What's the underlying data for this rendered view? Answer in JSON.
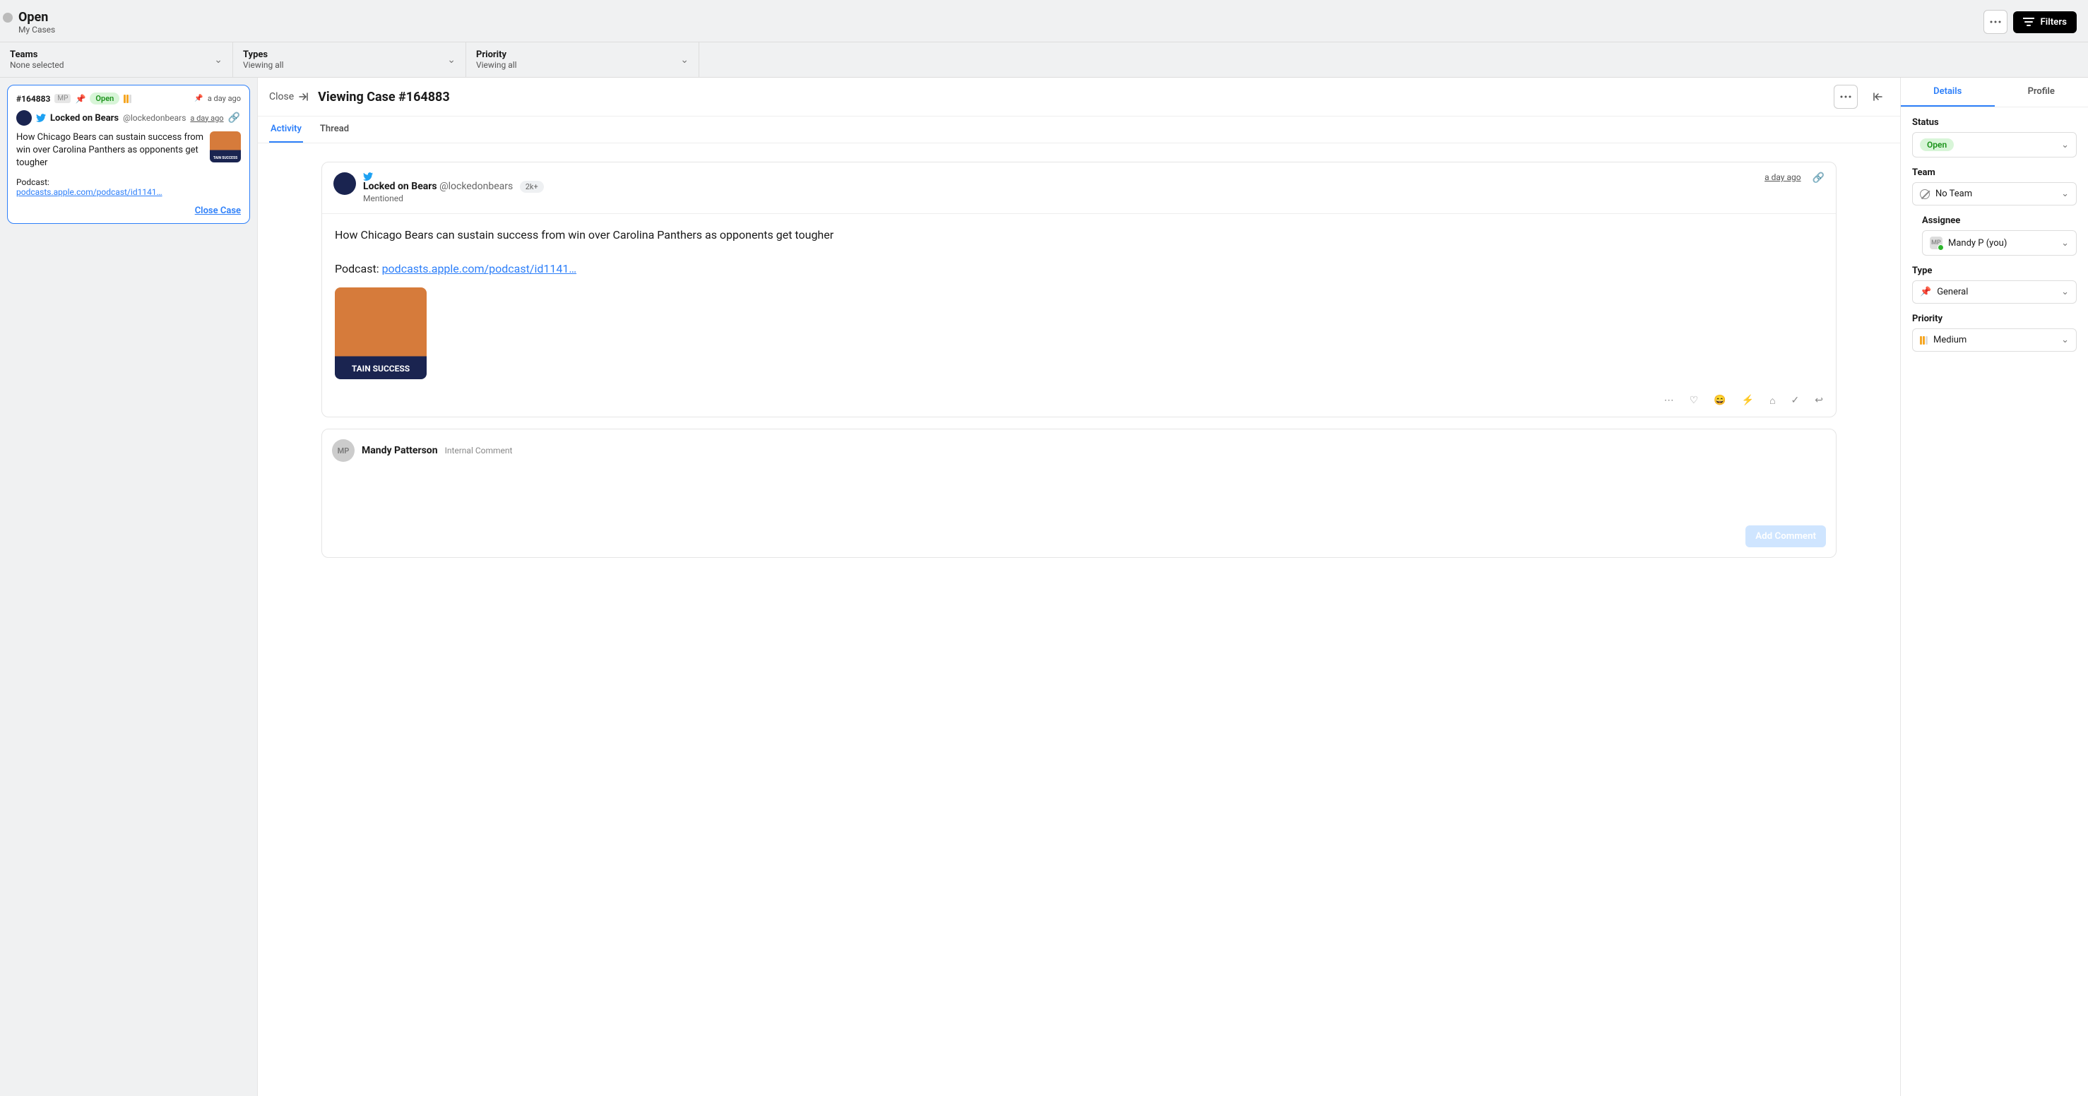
{
  "header": {
    "title": "Open",
    "subtitle": "My Cases",
    "more_icon": "more",
    "filters_label": "Filters"
  },
  "filters": [
    {
      "label": "Teams",
      "value": "None selected"
    },
    {
      "label": "Types",
      "value": "Viewing all"
    },
    {
      "label": "Priority",
      "value": "Viewing all"
    }
  ],
  "sidebar": {
    "case": {
      "id": "#164883",
      "mp": "MP",
      "status": "Open",
      "time": "a day ago",
      "source_name": "Locked on Bears",
      "source_handle": "@lockedonbears",
      "source_time": "a day ago",
      "body": "How Chicago Bears can sustain success from win over Carolina Panthers as opponents get tougher",
      "podcast_label": "Podcast:",
      "podcast_link": "podcasts.apple.com/podcast/id1141…",
      "close_label": "Close Case"
    }
  },
  "caseview": {
    "close_label": "Close",
    "title": "Viewing Case #164883",
    "tabs": {
      "activity": "Activity",
      "thread": "Thread"
    },
    "post": {
      "name": "Locked on Bears",
      "handle": "@lockedonbears",
      "followers": "2k+",
      "mentioned": "Mentioned",
      "time": "a day ago",
      "body": "How Chicago Bears can sustain success from win over Carolina Panthers as opponents get tougher",
      "podcast_label": "Podcast: ",
      "podcast_link": "podcasts.apple.com/podcast/id1141…"
    },
    "comment": {
      "avatar": "MP",
      "name": "Mandy Patterson",
      "type": "Internal Comment",
      "button": "Add Comment"
    }
  },
  "details": {
    "tabs": {
      "details": "Details",
      "profile": "Profile"
    },
    "status": {
      "label": "Status",
      "value": "Open"
    },
    "team": {
      "label": "Team",
      "value": "No Team"
    },
    "assignee": {
      "label": "Assignee",
      "avatar": "MP",
      "value": "Mandy P (you)"
    },
    "type": {
      "label": "Type",
      "value": "General"
    },
    "priority": {
      "label": "Priority",
      "value": "Medium"
    }
  }
}
